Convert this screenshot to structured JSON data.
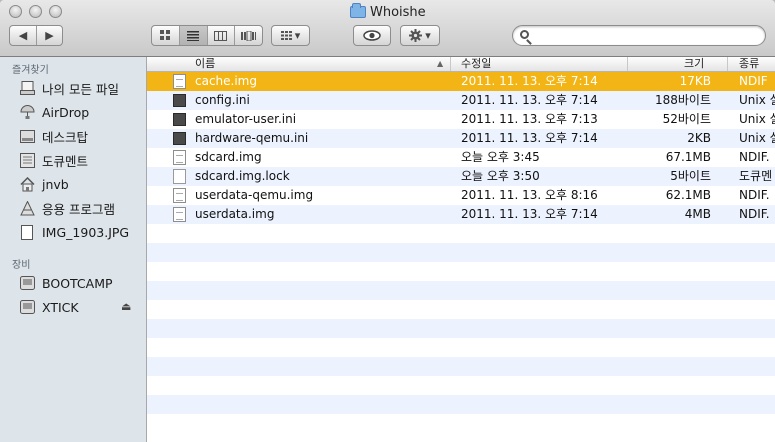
{
  "window": {
    "title": "Whoishe"
  },
  "toolbar": {
    "nav": {
      "back": "◀",
      "forward": "▶"
    },
    "view_modes": [
      "icon",
      "list",
      "column",
      "coverflow"
    ],
    "arrange_caret": "▾",
    "quicklook": "quick-look",
    "action_caret": "▾",
    "search": {
      "value": "",
      "placeholder": ""
    }
  },
  "sidebar": {
    "favorites_heading": "즐겨찾기",
    "favorites": [
      {
        "label": "나의 모든 파일",
        "icon": "all-files-icon"
      },
      {
        "label": "AirDrop",
        "icon": "airdrop-icon"
      },
      {
        "label": "데스크탑",
        "icon": "desktop-icon"
      },
      {
        "label": "도큐멘트",
        "icon": "documents-icon"
      },
      {
        "label": "jnvb",
        "icon": "home-icon"
      },
      {
        "label": "응용 프로그램",
        "icon": "applications-icon"
      },
      {
        "label": "IMG_1903.JPG",
        "icon": "file-icon"
      }
    ],
    "devices_heading": "장비",
    "devices": [
      {
        "label": "BOOTCAMP",
        "icon": "disk-icon"
      },
      {
        "label": "XTICK",
        "icon": "disk-icon",
        "eject": "⏏"
      }
    ]
  },
  "list": {
    "columns": {
      "name": "이름",
      "date": "수정일",
      "size": "크기",
      "kind": "종류"
    },
    "rows": [
      {
        "name": "cache.img",
        "date": "2011. 11. 13. 오후 7:14",
        "size": "17KB",
        "kind": "NDIF",
        "icon": "doc"
      },
      {
        "name": "config.ini",
        "date": "2011. 11. 13. 오후 7:14",
        "size": "188바이트",
        "kind": "Unix 실",
        "icon": "dark"
      },
      {
        "name": "emulator-user.ini",
        "date": "2011. 11. 13. 오후 7:13",
        "size": "52바이트",
        "kind": "Unix 실",
        "icon": "dark"
      },
      {
        "name": "hardware-qemu.ini",
        "date": "2011. 11. 13. 오후 7:14",
        "size": "2KB",
        "kind": "Unix 실",
        "icon": "dark"
      },
      {
        "name": "sdcard.img",
        "date": "오늘 오후 3:45",
        "size": "67.1MB",
        "kind": "NDIF.",
        "icon": "doc"
      },
      {
        "name": "sdcard.img.lock",
        "date": "오늘 오후 3:50",
        "size": "5바이트",
        "kind": "도큐멘",
        "icon": "plain"
      },
      {
        "name": "userdata-qemu.img",
        "date": "2011. 11. 13. 오후 8:16",
        "size": "62.1MB",
        "kind": "NDIF.",
        "icon": "doc"
      },
      {
        "name": "userdata.img",
        "date": "2011. 11. 13. 오후 7:14",
        "size": "4MB",
        "kind": "NDIF.",
        "icon": "doc"
      }
    ],
    "selected_index": 0
  }
}
